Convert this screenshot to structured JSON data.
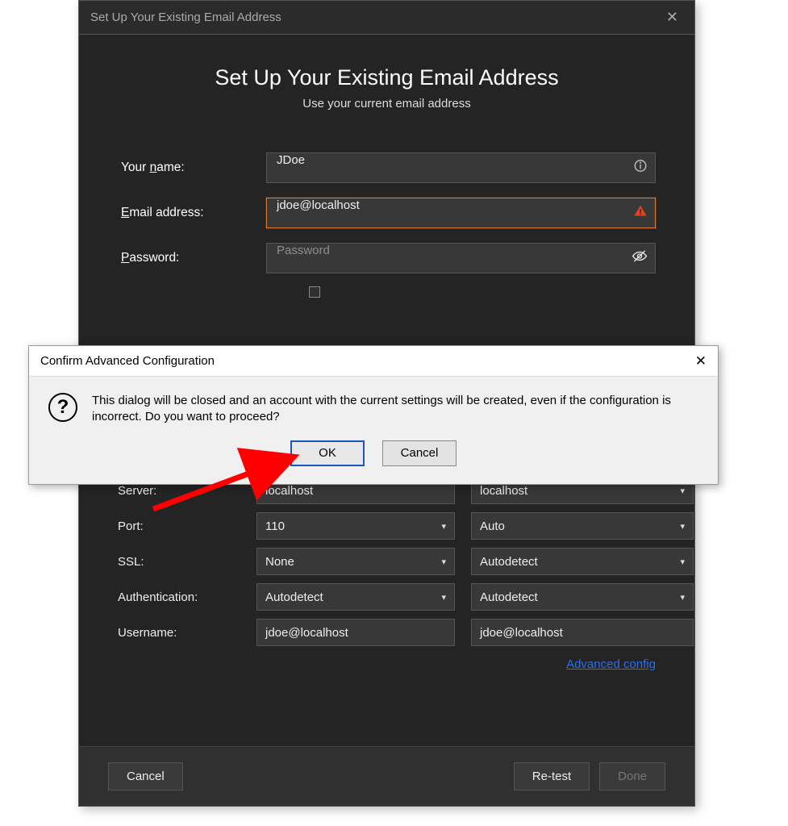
{
  "main": {
    "window_title": "Set Up Your Existing Email Address",
    "headline": "Set Up Your Existing Email Address",
    "subline": "Use your current email address",
    "labels": {
      "name": "Your ",
      "name_u": "n",
      "name_rest": "ame:",
      "email": "E",
      "email_u": "",
      "email_rest": "mail address:",
      "password": "P",
      "password_rest": "assword:"
    },
    "name_value": "JDoe",
    "email_value": "jdoe@localhost",
    "password_placeholder": "Password",
    "grid_labels": {
      "server": "Server:",
      "port": "Port:",
      "ssl": "SSL:",
      "auth": "Authentication:",
      "user": "Username:"
    },
    "incoming": {
      "server": "localhost",
      "port": "110",
      "ssl": "None",
      "auth": "Autodetect",
      "user": "jdoe@localhost"
    },
    "outgoing": {
      "server": "localhost",
      "port": "Auto",
      "ssl": "Autodetect",
      "auth": "Autodetect",
      "user": "jdoe@localhost"
    },
    "adv_link": "Advanced config",
    "buttons": {
      "cancel": "Cancel",
      "retest": "Re-test",
      "done": "Done"
    }
  },
  "popup": {
    "title": "Confirm Advanced Configuration",
    "message": "This dialog will be closed and an account with the current settings will be created, even if the configuration is incorrect. Do you want to proceed?",
    "ok": "OK",
    "cancel": "Cancel"
  }
}
